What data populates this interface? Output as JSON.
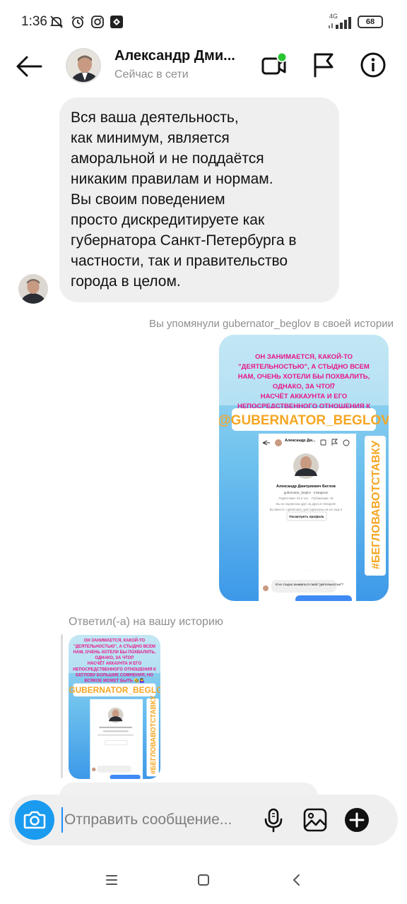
{
  "status_bar": {
    "time": "1:36",
    "network": "4G",
    "battery": "68",
    "icons": [
      "no-sound-icon",
      "alarm-icon",
      "instagram-icon",
      "app-icon",
      "signal-icon",
      "battery-icon"
    ]
  },
  "header": {
    "name": "Александр Дми...",
    "status": "Сейчас в сети",
    "online_dot_color": "#29c431",
    "icons": [
      "back-arrow-icon",
      "video-call-icon",
      "flag-icon",
      "info-icon"
    ]
  },
  "message": {
    "text": "Вся ваша деятельность,\nкак минимум, является\nаморальной и не поддаётся\nникаким правилам и нормам.\nВы своим поведением\nпросто дискредитируете как\nгубернатора Санкт-Петербурга в\nчастности, так и правительство\nгорода в целом."
  },
  "mention": {
    "caption": "Вы упомянули gubernator_beglov в своей истории",
    "story_text_lines": [
      "ОН ЗАНИМАЕТСЯ, КАКОЙ-ТО",
      "\"ДЕЯТЕЛЬНОСТЬЮ\", А СТЫДНО ВСЕМ",
      "НАМ, ОЧЕНЬ ХОТЕЛИ БЫ ПОХВАЛИТЬ,",
      "ОДНАКО, ЗА ЧТО⁉",
      "НАСЧЁТ АККАУНТА И ЕГО",
      "НЕПОСРЕДСТВЕННОГО ОТНОШЕНИЯ К",
      "БЕГЛОВУ БОЛЬШИЕ СОМНЕНИЯ, НО",
      "ВСЯКОЕ МОЖЕТ БЫТЬ 🤣🤷‍♀️"
    ],
    "mention_tag": "@GUBERNATOR_BEGLOV",
    "hashtag": "#БЕГЛОВАВОТСТАВКУ",
    "inner_header_name": "Александр Дм...",
    "inner_profile_name": "Александр Дмитриевич Беглов",
    "inner_username": "gubernator_beglov · Instagram",
    "inner_stats": "Подписчики: 31,5 тыс. · Публикации: 19",
    "inner_line1": "Вы не подписаны друг на друга в Instagram",
    "inner_line2": "Вы вместе с gubernator_spb подписаны на его ещё 4",
    "inner_view_profile": "Посмотреть профиль",
    "inner_msg": "И не стыдно заниматься такой \"деятельностью\"?"
  },
  "reply": {
    "caption": "Ответил(-а) на вашу историю"
  },
  "composer": {
    "placeholder": "Отправить сообщение...",
    "icons": [
      "camera-icon",
      "microphone-icon",
      "gallery-icon",
      "add-icon"
    ]
  },
  "navbar": {
    "icons": [
      "menu-icon",
      "home-square-icon",
      "back-chevron-icon"
    ]
  },
  "colors": {
    "accent_blue": "#1a9bf0",
    "bubble_gray": "#efefef",
    "story_pink": "#e8168a"
  }
}
